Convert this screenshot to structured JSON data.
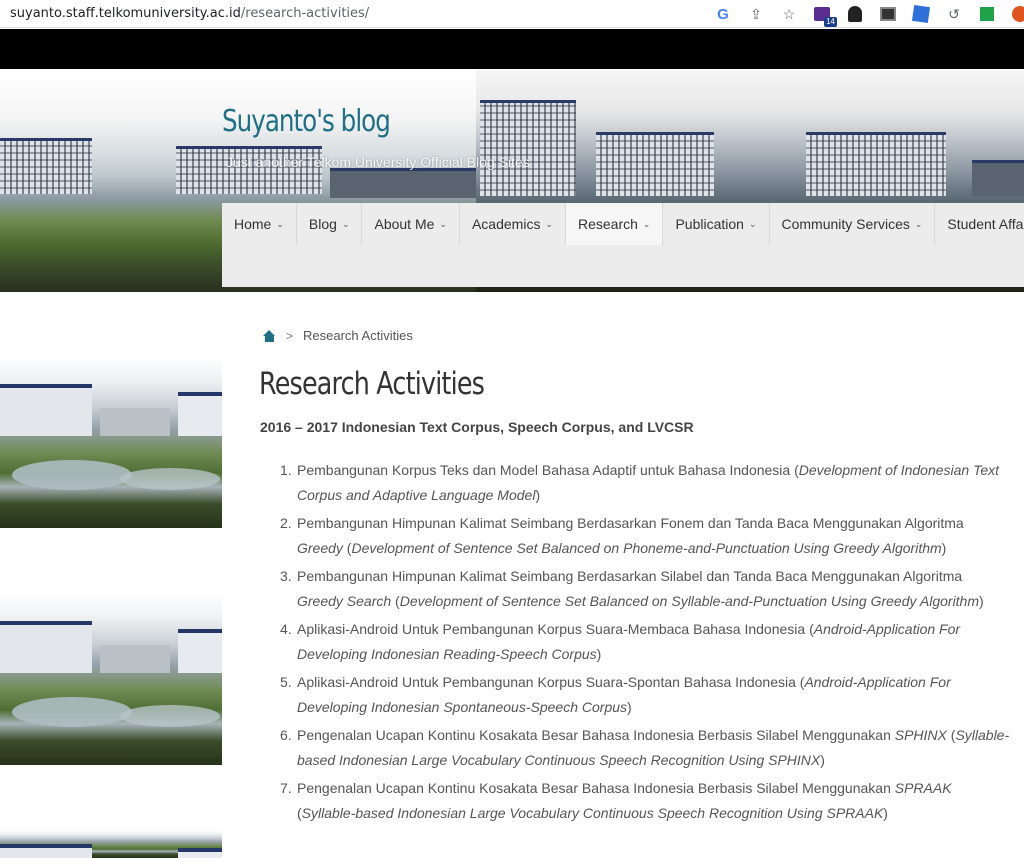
{
  "browser": {
    "url_host": "suyanto.staff.telkomuniversity.ac.id",
    "url_path": "/research-activities/",
    "extension_badge": "14",
    "icons": [
      "google-icon",
      "share-icon",
      "bookmark-star-icon",
      "extension-purple-icon",
      "extension-dark-icon",
      "extension-news-icon",
      "extension-blue-icon",
      "history-icon",
      "extension-green-icon",
      "wordpress-icon"
    ]
  },
  "site": {
    "title": "Suyanto's blog",
    "tagline": "Just another Telkom University Official Blog Sites"
  },
  "nav": {
    "items": [
      {
        "label": "Home",
        "dropdown": true
      },
      {
        "label": "Blog",
        "dropdown": true
      },
      {
        "label": "About Me",
        "dropdown": true
      },
      {
        "label": "Academics",
        "dropdown": true
      },
      {
        "label": "Research",
        "dropdown": true,
        "active": true
      },
      {
        "label": "Publication",
        "dropdown": true
      },
      {
        "label": "Community Services",
        "dropdown": true
      },
      {
        "label": "Student Affairs",
        "dropdown": false
      }
    ]
  },
  "breadcrumb": {
    "separator": ">",
    "current": "Research Activities"
  },
  "page": {
    "title": "Research Activities",
    "subtitle": "2016 – 2017 Indonesian Text Corpus, Speech Corpus, and LVCSR",
    "items": [
      {
        "num": "1.",
        "text": "Pembangunan Korpus Teks dan Model Bahasa Adaptif untuk Bahasa Indonesia (",
        "en": "Development of Indonesian Text Corpus and Adaptive Language Model",
        "close": ")"
      },
      {
        "num": "2.",
        "text": "Pembangunan Himpunan Kalimat Seimbang Berdasarkan Fonem dan Tanda Baca Menggunakan Algoritma ",
        "algo": "Greedy",
        "mid": " (",
        "en": "Development of Sentence Set Balanced on Phoneme-and-Punctuation Using Greedy Algorithm",
        "close": ")"
      },
      {
        "num": "3.",
        "text": "Pembangunan Himpunan Kalimat Seimbang Berdasarkan Silabel dan Tanda Baca Menggunakan Algoritma ",
        "algo": "Greedy Search",
        "mid": " (",
        "en": "Development of Sentence Set Balanced on Syllable-and-Punctuation Using Greedy Algorithm",
        "close": ")"
      },
      {
        "num": "4.",
        "text": "Aplikasi-Android Untuk Pembangunan Korpus Suara-Membaca Bahasa Indonesia (",
        "en": "Android-Application For Developing Indonesian Reading-Speech Corpus",
        "close": ")"
      },
      {
        "num": "5.",
        "text": "Aplikasi-Android Untuk Pembangunan Korpus Suara-Spontan Bahasa Indonesia (",
        "en": "Android-Application For Developing Indonesian Spontaneous-Speech Corpus",
        "close": ")"
      },
      {
        "num": "6.",
        "text": "Pengenalan Ucapan Kontinu Kosakata Besar Bahasa Indonesia Berbasis Silabel Menggunakan ",
        "algo": "SPHINX",
        "mid": " (",
        "en": "Syllable-based Indonesian Large Vocabulary Continuous Speech Recognition Using SPHINX",
        "close": ")"
      },
      {
        "num": "7.",
        "text": "Pengenalan Ucapan Kontinu Kosakata Besar Bahasa Indonesia Berbasis Silabel Menggunakan ",
        "algo": "SPRAAK",
        "mid": " (",
        "en": "Syllable-based Indonesian Large Vocabulary Continuous Speech Recognition Using SPRAAK",
        "close": ")"
      }
    ]
  },
  "colors": {
    "accent": "#1f6f86",
    "topbar": "#000000",
    "nav_bg": "#ececec",
    "text": "#555555"
  }
}
